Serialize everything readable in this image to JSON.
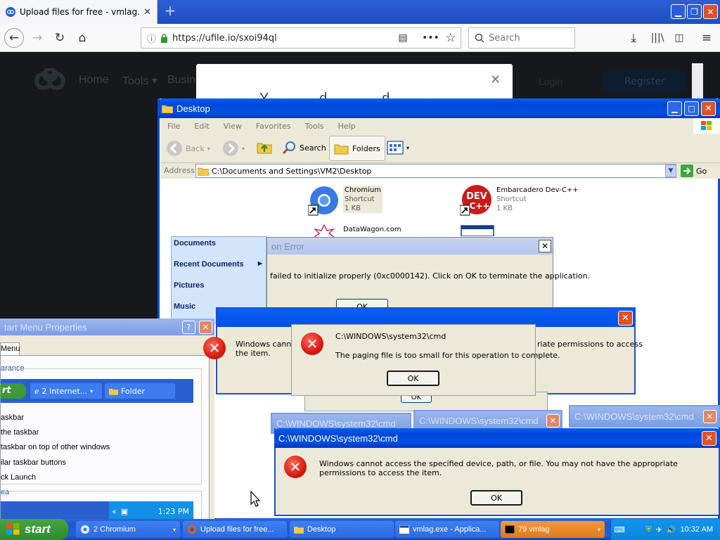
{
  "browser": {
    "tab_title": "Upload files for free - vmlag.exe -",
    "url": "https://ufile.io/sxoi94ql",
    "search_placeholder": "Search",
    "new_tab": "+"
  },
  "webpage": {
    "nav": [
      "Home",
      "Tools",
      "Busin"
    ],
    "login": "Login",
    "register": "Register",
    "modal_close": "✕",
    "modal_text": "Y             d              d"
  },
  "explorer": {
    "title": "Desktop",
    "menu": [
      "File",
      "Edit",
      "View",
      "Favorites",
      "Tools",
      "Help"
    ],
    "toolbar": {
      "back": "Back",
      "search": "Search",
      "folders": "Folders"
    },
    "address_label": "Address",
    "address_value": "C:\\Documents and Settings\\VM2\\Desktop",
    "go": "Go",
    "files": [
      {
        "name": "Chromium",
        "type": "Shortcut",
        "size": "1 KB"
      },
      {
        "name": "Embarcadero Dev-C++",
        "type": "Shortcut",
        "size": "1 KB"
      },
      {
        "name": "DataWagon.com",
        "type": "",
        "size": ""
      }
    ]
  },
  "start_menu_fragment": {
    "items": [
      "Documents",
      "Recent Documents",
      "Pictures",
      "Music"
    ]
  },
  "app_error": {
    "title": "on Error",
    "message": "failed to initialize properly (0xc0000142). Click on OK to terminate the application.",
    "ok": "OK"
  },
  "paging_error": {
    "title": "C:\\WINDOWS\\system32\\cmd",
    "message": "The paging file is too small for this operation to complete.",
    "ok": "OK"
  },
  "behind_error": {
    "left_text": "Windows cannot access the specified device, path, or file. You may not have the appropriate permissions to access the item.",
    "left_visible": "Windows cannot",
    "left_visible2": "the item.",
    "right_visible": "riate permissions to access",
    "ok": "OK"
  },
  "cmd_windows": {
    "titles": [
      "C:\\WINDOWS\\system32\\cmd",
      "C:\\WINDOWS\\system32\\cmd",
      "C:\\WINDOWS\\system32\\cmd"
    ]
  },
  "main_error": {
    "title": "C:\\WINDOWS\\system32\\cmd",
    "message": "Windows cannot access the specified device, path, or file.  You may not have the appropriate permissions to access the item.",
    "ok": "OK"
  },
  "start_menu_props": {
    "title": "tart Menu Properties",
    "tab": "Menu",
    "group_appearance": "arance",
    "preview_start": "rt",
    "preview_task1": "2 Internet...",
    "preview_task2": "Folder",
    "options": [
      "askbar",
      "the taskbar",
      "taskbar on top of other windows",
      "ilar taskbar buttons",
      "ck Launch"
    ],
    "group_area": "ea",
    "preview_clock": "1:23 PM"
  },
  "taskbar": {
    "start": "start",
    "buttons": [
      "2 Chromium",
      "Upload files for free...",
      "Desktop",
      "vmlag.exe - Applica...",
      "79 vmlag"
    ],
    "clock": "10:32 AM"
  }
}
